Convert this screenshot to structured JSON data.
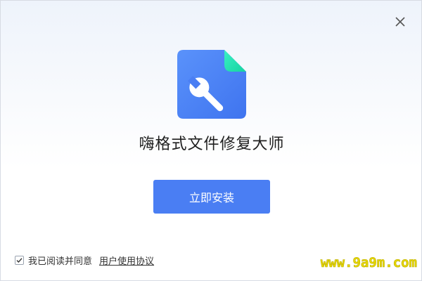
{
  "window": {
    "close_icon": "close-icon"
  },
  "app": {
    "icon": "file-wrench-icon",
    "title": "嗨格式文件修复大师"
  },
  "install": {
    "button_label": "立即安装"
  },
  "agreement": {
    "checked": true,
    "label": "我已阅读并同意",
    "link_label": "用户使用协议"
  },
  "watermark": {
    "text": "www.9a9m.com"
  },
  "colors": {
    "accent": "#4a7ef3",
    "icon_blue": "#4f86f7",
    "icon_corner": "#2ee6b6",
    "watermark": "#e8d800"
  }
}
